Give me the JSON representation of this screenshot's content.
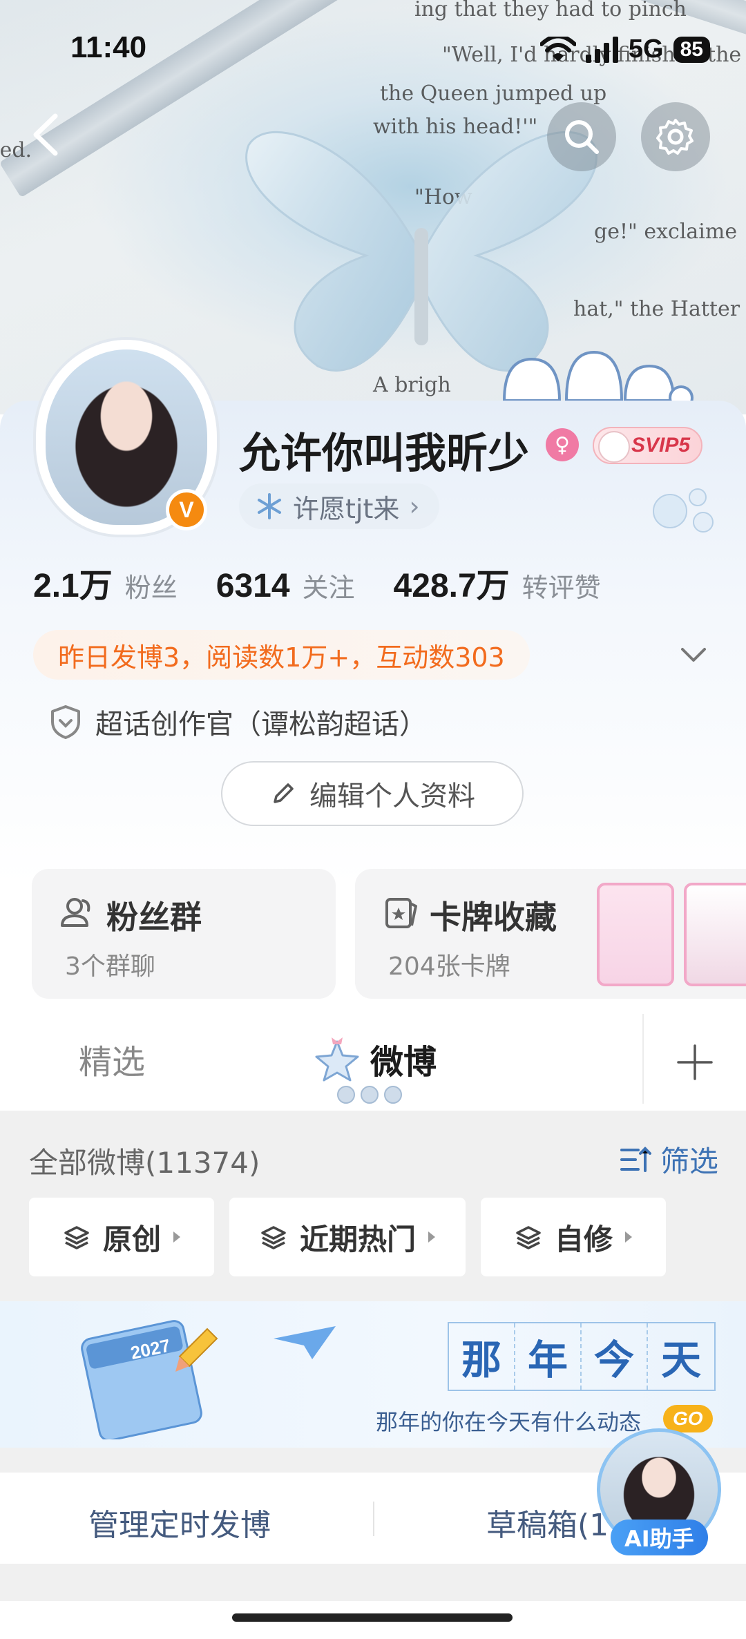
{
  "status_bar": {
    "time": "11:40",
    "network": "5G",
    "battery": "85"
  },
  "profile": {
    "username": "允许你叫我昕少",
    "svip_label": "SVIP5",
    "verified_badge": "V",
    "wish_tag": "许愿tjt来",
    "stats": [
      {
        "value": "2.1万",
        "label": "粉丝"
      },
      {
        "value": "6314",
        "label": "关注"
      },
      {
        "value": "428.7万",
        "label": "转评赞"
      }
    ],
    "activity_summary": "昨日发博3，阅读数1万+，互动数303",
    "superchat_role": "超话创作官（谭松韵超话）",
    "edit_profile_label": "编辑个人资料"
  },
  "cards": {
    "fan_group": {
      "title": "粉丝群",
      "subtitle": "3个群聊"
    },
    "card_collection": {
      "title": "卡牌收藏",
      "subtitle": "204张卡牌"
    }
  },
  "tabs": [
    {
      "label": "精选",
      "active": false
    },
    {
      "label": "微博",
      "active": true
    }
  ],
  "feed": {
    "all_posts_label": "全部微博(11374)",
    "filter_label": "筛选",
    "chips": [
      "原创",
      "近期热门",
      "自修"
    ],
    "memory_banner": {
      "title_chars": [
        "那",
        "年",
        "今",
        "天"
      ],
      "subtitle": "那年的你在今天有什么动态",
      "go_label": "GO",
      "calendar_year": "2027"
    },
    "actions": [
      "管理定时发博",
      "草稿箱(1"
    ]
  },
  "ai_assistant": {
    "label": "AI助手"
  },
  "colors": {
    "accent_orange": "#f26b1d",
    "link_blue": "#3d72b4",
    "verified_orange": "#f58a10",
    "svip_red": "#d8364a"
  }
}
